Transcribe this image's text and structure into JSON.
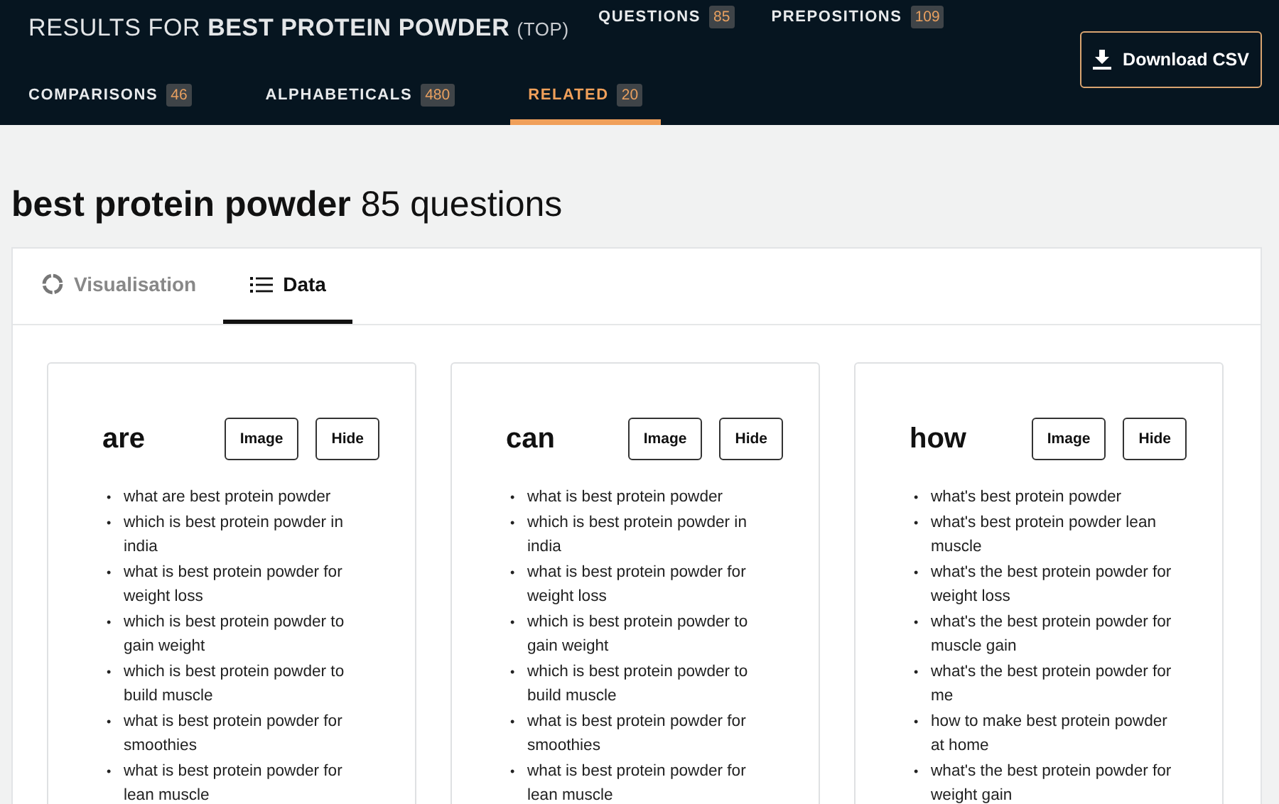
{
  "header": {
    "title_prefix": "RESULTS FOR",
    "query": "BEST PROTEIN POWDER",
    "scope": "(TOP)",
    "top_tabs": [
      {
        "label": "QUESTIONS",
        "count": "85",
        "selected": false
      },
      {
        "label": "PREPOSITIONS",
        "count": "109",
        "selected": false
      }
    ],
    "bottom_tabs": [
      {
        "label": "COMPARISONS",
        "count": "46",
        "selected": false
      },
      {
        "label": "ALPHABETICALS",
        "count": "480",
        "selected": false
      },
      {
        "label": "RELATED",
        "count": "20",
        "selected": true
      }
    ],
    "download_button": "Download CSV"
  },
  "heading": {
    "query": "best protein powder",
    "count": "85 questions"
  },
  "view_tabs": [
    {
      "label": "Visualisation",
      "kind": "ring",
      "selected": false
    },
    {
      "label": "Data",
      "kind": "list",
      "selected": true
    }
  ],
  "cards": [
    {
      "title": "are",
      "buttons": [
        "Image",
        "Hide"
      ],
      "marker": "•",
      "items": [
        "what are best protein powder",
        "which is best protein powder in india",
        "what is best protein powder for weight loss",
        "which is best protein powder to gain weight",
        "which is best protein powder to build muscle",
        "what is best protein powder for smoothies",
        "what is best protein powder for lean muscle"
      ]
    },
    {
      "title": "can",
      "buttons": [
        "Image",
        "Hide"
      ],
      "marker": "•",
      "items": [
        "what is best protein powder",
        "which is best protein powder in india",
        "what is best protein powder for weight loss",
        "which is best protein powder to gain weight",
        "which is best protein powder to build muscle",
        "what is best protein powder for smoothies",
        "what is best protein powder for lean muscle"
      ]
    },
    {
      "title": "how",
      "buttons": [
        "Image",
        "Hide"
      ],
      "marker": "•",
      "items": [
        "what's best protein powder",
        "what's best protein powder lean muscle",
        "what's the best protein powder for weight loss",
        "what's the best protein powder for muscle gain",
        "what's the best protein powder for me",
        "how to make best protein powder at home",
        "what's the best protein powder for weight gain"
      ]
    }
  ]
}
